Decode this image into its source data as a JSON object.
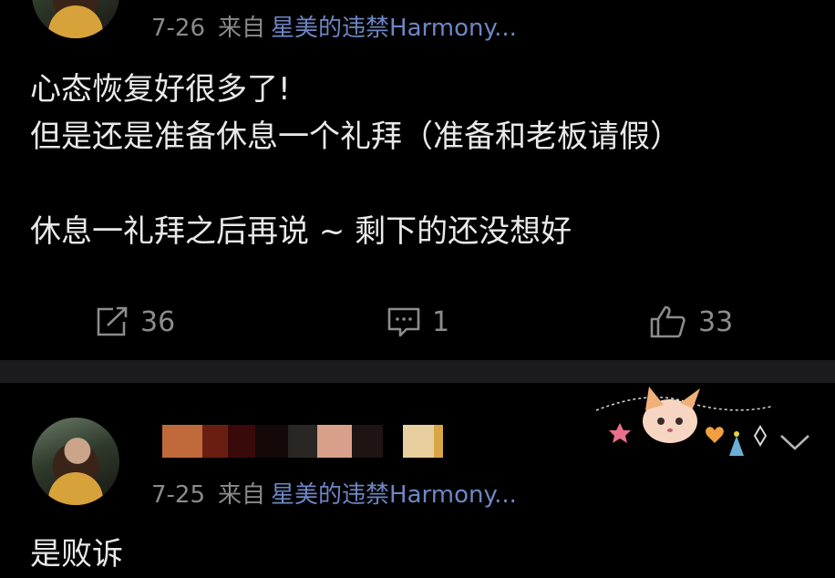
{
  "posts": [
    {
      "date": "7-26",
      "via_prefix": "来自",
      "source": "星美的违禁Harmony...",
      "text": "心态恢复好很多了!\n但是还是准备休息一个礼拜（准备和老板请假）\n\n休息一礼拜之后再说 ~ 剩下的还没想好",
      "actions": {
        "repost": "36",
        "comment": "1",
        "like": "33"
      }
    },
    {
      "date": "7-25",
      "via_prefix": "来自",
      "source": "星美的违禁Harmony...",
      "text": "是败诉"
    }
  ],
  "colors": {
    "source_link": "#6e86c2",
    "meta": "#8a8a8a",
    "background": "#000000",
    "divider": "#1b1b1d"
  },
  "icons": {
    "repost": "repost-icon",
    "comment": "comment-icon",
    "like": "thumbs-up-icon",
    "more": "chevron-down-icon"
  }
}
